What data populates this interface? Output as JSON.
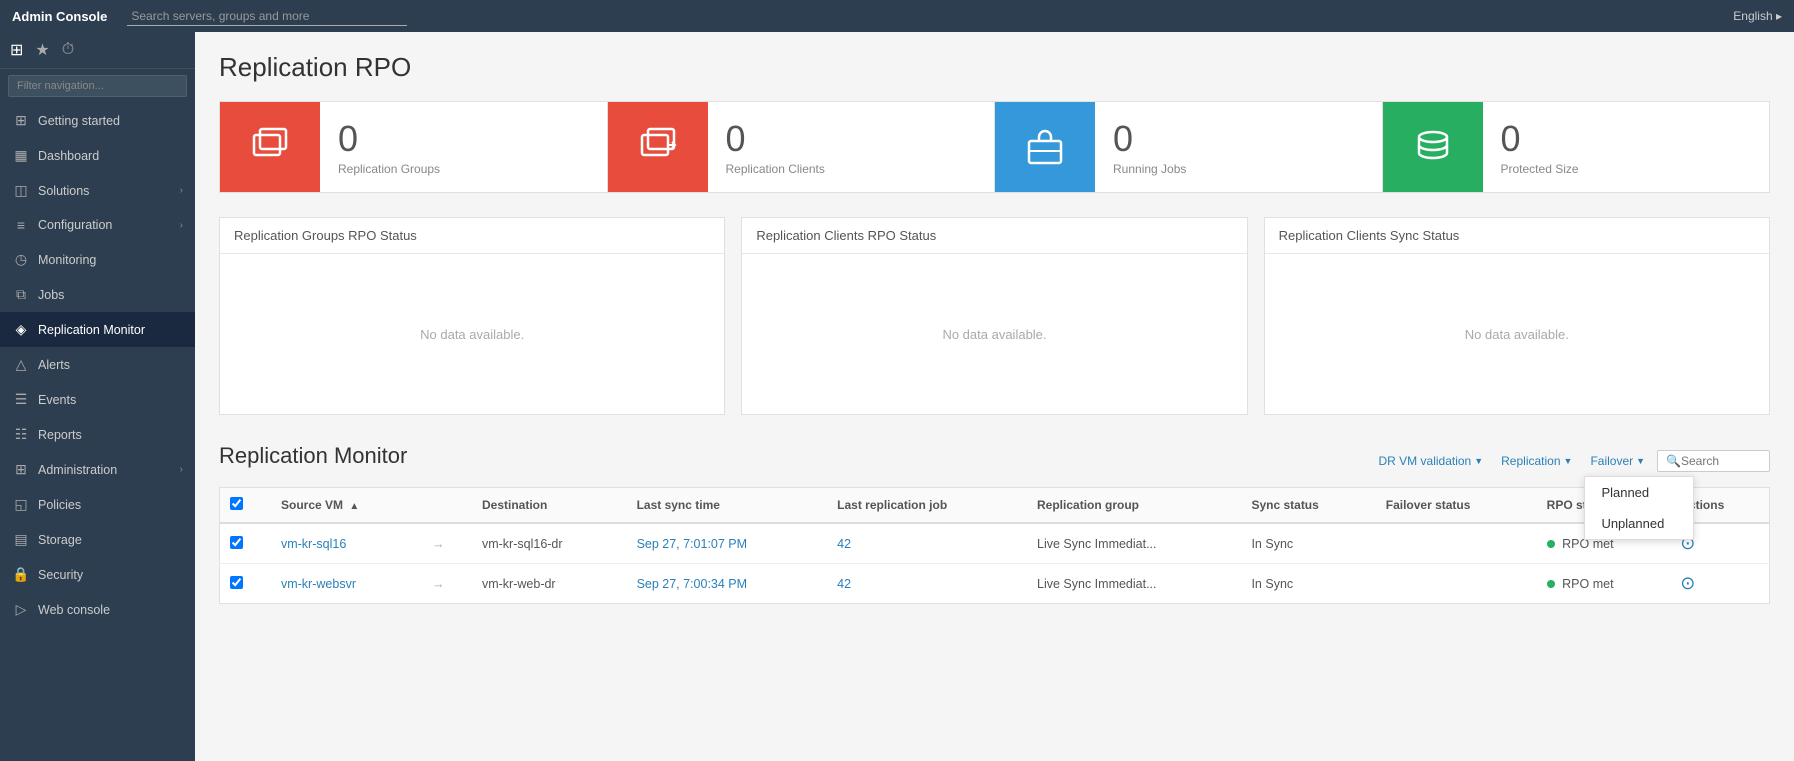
{
  "topBar": {
    "title": "Admin Console",
    "searchPlaceholder": "Search servers, groups and more",
    "language": "English ▸"
  },
  "sidebar": {
    "filterPlaceholder": "Filter navigation...",
    "items": [
      {
        "id": "getting-started",
        "label": "Getting started",
        "icon": "⊞",
        "active": false,
        "hasArrow": false
      },
      {
        "id": "dashboard",
        "label": "Dashboard",
        "icon": "▦",
        "active": false,
        "hasArrow": false
      },
      {
        "id": "solutions",
        "label": "Solutions",
        "icon": "◫",
        "active": false,
        "hasArrow": true
      },
      {
        "id": "configuration",
        "label": "Configuration",
        "icon": "≡",
        "active": false,
        "hasArrow": true
      },
      {
        "id": "monitoring",
        "label": "Monitoring",
        "icon": "◷",
        "active": false,
        "hasArrow": false
      },
      {
        "id": "jobs",
        "label": "Jobs",
        "icon": "⧉",
        "active": false,
        "hasArrow": false
      },
      {
        "id": "replication-monitor",
        "label": "Replication Monitor",
        "icon": "◈",
        "active": true,
        "hasArrow": false
      },
      {
        "id": "alerts",
        "label": "Alerts",
        "icon": "△",
        "active": false,
        "hasArrow": false
      },
      {
        "id": "events",
        "label": "Events",
        "icon": "☰",
        "active": false,
        "hasArrow": false
      },
      {
        "id": "reports",
        "label": "Reports",
        "icon": "☷",
        "active": false,
        "hasArrow": false
      },
      {
        "id": "administration",
        "label": "Administration",
        "icon": "⊞",
        "active": false,
        "hasArrow": true
      },
      {
        "id": "policies",
        "label": "Policies",
        "icon": "◱",
        "active": false,
        "hasArrow": false
      },
      {
        "id": "storage",
        "label": "Storage",
        "icon": "▤",
        "active": false,
        "hasArrow": false
      },
      {
        "id": "security",
        "label": "Security",
        "icon": "🔒",
        "active": false,
        "hasArrow": false
      },
      {
        "id": "web-console",
        "label": "Web console",
        "icon": "▷",
        "active": false,
        "hasArrow": false
      }
    ]
  },
  "page": {
    "title": "Replication RPO",
    "stats": [
      {
        "id": "replication-groups",
        "value": "0",
        "label": "Replication Groups",
        "colorClass": "red",
        "icon": "copy"
      },
      {
        "id": "replication-clients",
        "value": "0",
        "label": "Replication Clients",
        "colorClass": "red",
        "icon": "replicate"
      },
      {
        "id": "running-jobs",
        "value": "0",
        "label": "Running Jobs",
        "colorClass": "blue",
        "icon": "briefcase"
      },
      {
        "id": "protected-size",
        "value": "0",
        "label": "Protected Size",
        "colorClass": "green",
        "icon": "database"
      }
    ],
    "statusPanels": [
      {
        "id": "groups-rpo",
        "title": "Replication Groups RPO Status",
        "noData": "No data available."
      },
      {
        "id": "clients-rpo",
        "title": "Replication Clients RPO Status",
        "noData": "No data available."
      },
      {
        "id": "clients-sync",
        "title": "Replication Clients Sync Status",
        "noData": "No data available."
      }
    ],
    "monitor": {
      "title": "Replication Monitor",
      "filters": {
        "drVmValidation": "DR VM validation",
        "replication": "Replication",
        "failover": "Failover",
        "searchPlaceholder": "Search"
      },
      "failoverDropdown": {
        "visible": true,
        "items": [
          "Planned",
          "Unplanned"
        ]
      },
      "tableHeaders": [
        {
          "id": "checkbox",
          "label": ""
        },
        {
          "id": "source-vm",
          "label": "Source VM",
          "sortable": true,
          "sortDir": "asc"
        },
        {
          "id": "arrow",
          "label": ""
        },
        {
          "id": "destination",
          "label": "Destination"
        },
        {
          "id": "last-sync-time",
          "label": "Last sync time"
        },
        {
          "id": "last-replication-job",
          "label": "Last replication job"
        },
        {
          "id": "replication-group",
          "label": "Replication group"
        },
        {
          "id": "sync-status",
          "label": "Sync status"
        },
        {
          "id": "failover-status",
          "label": "Failover status"
        },
        {
          "id": "rpo-status",
          "label": "RPO status"
        },
        {
          "id": "actions",
          "label": "Actions"
        }
      ],
      "tableRows": [
        {
          "checked": true,
          "sourceVm": "vm-kr-sql16",
          "destination": "vm-kr-sql16-dr",
          "lastSyncTime": "Sep 27, 7:01:07 PM",
          "lastReplicationJob": "42",
          "replicationGroup": "Live Sync Immediat...",
          "syncStatus": "In Sync",
          "failoverStatus": "",
          "rpoStatus": "RPO met",
          "rpoStatusDot": true
        },
        {
          "checked": true,
          "sourceVm": "vm-kr-websvr",
          "destination": "vm-kr-web-dr",
          "lastSyncTime": "Sep 27, 7:00:34 PM",
          "lastReplicationJob": "42",
          "replicationGroup": "Live Sync Immediat...",
          "syncStatus": "In Sync",
          "failoverStatus": "",
          "rpoStatus": "RPO met",
          "rpoStatusDot": true
        }
      ]
    }
  }
}
